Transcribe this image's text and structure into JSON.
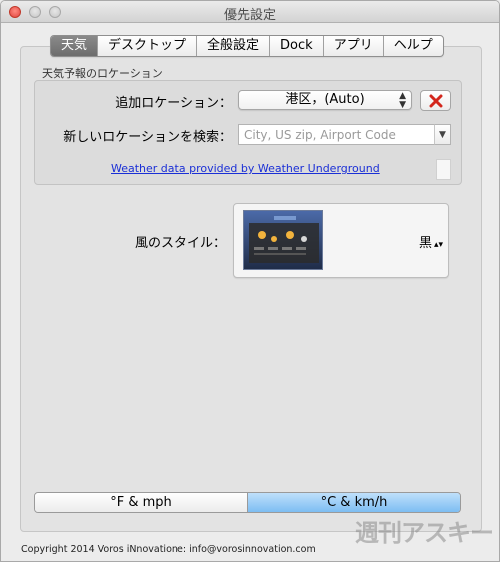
{
  "window": {
    "title": "優先設定"
  },
  "tabs": [
    {
      "label": "天気",
      "active": true
    },
    {
      "label": "デスクトップ",
      "active": false
    },
    {
      "label": "全般設定",
      "active": false
    },
    {
      "label": "Dock",
      "active": false
    },
    {
      "label": "アプリ",
      "active": false
    },
    {
      "label": "ヘルプ",
      "active": false
    }
  ],
  "location_group": {
    "title": "天気予報のロケーション",
    "add_location_label": "追加ロケーション：",
    "add_location_value": "港区，(Auto)",
    "remove_icon": "red-x-icon",
    "search_label": "新しいロケーションを検索：",
    "search_placeholder": "City, US zip, Airport Code",
    "credit_link": "Weather data provided by Weather Underground"
  },
  "style": {
    "label": "風のスタイル：",
    "value": "黒"
  },
  "units": {
    "options": [
      "°F & mph",
      "°C & km/h"
    ],
    "selected": 1
  },
  "footer": {
    "copyright": "Copyright 2014 Voros iNnovation",
    "email": "e: info@vorosinnovation.com"
  },
  "watermark": "週刊アスキー",
  "colors": {
    "selected_tab": "#7a7a7a",
    "link": "#1a2fd6",
    "remove_x": "#d3261c",
    "selected_segment": "#8fc8f5"
  }
}
